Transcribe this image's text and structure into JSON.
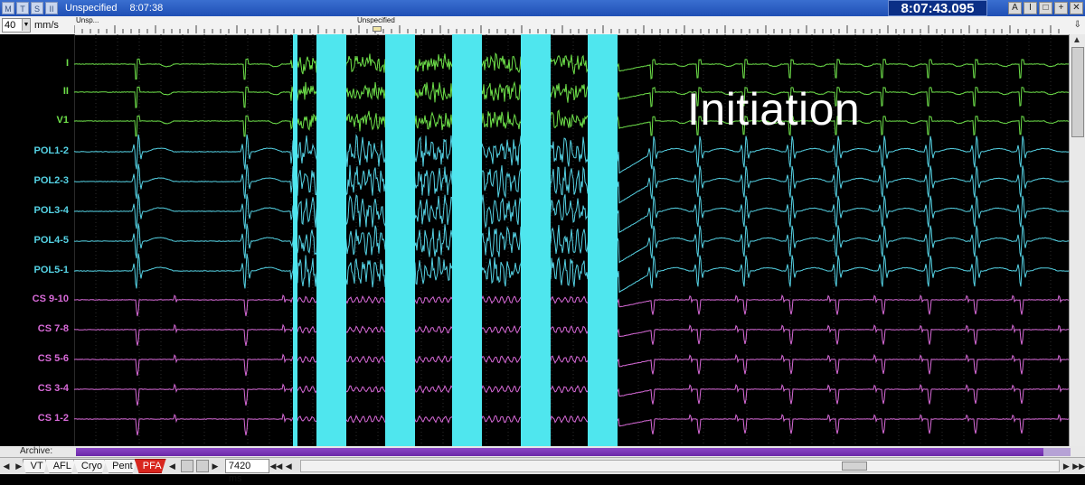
{
  "titlebar": {
    "buttons": [
      "M",
      "T",
      "S",
      "II"
    ],
    "title": "Unspecified",
    "time": "8:07:38",
    "clock": "8:07:43.095",
    "window_buttons": [
      "A",
      "I",
      "□",
      "+",
      "✕"
    ]
  },
  "toolbar": {
    "speed_value": "40",
    "speed_unit": "mm/s",
    "marker_left": "Unsp...",
    "marker_center": "Unspecified"
  },
  "channels": [
    {
      "label": "I",
      "color": "#6ee04a"
    },
    {
      "label": "II",
      "color": "#6ee04a"
    },
    {
      "label": "V1",
      "color": "#6ee04a"
    },
    {
      "label": "POL1-2",
      "color": "#55d2e4"
    },
    {
      "label": "POL2-3",
      "color": "#55d2e4"
    },
    {
      "label": "POL3-4",
      "color": "#55d2e4"
    },
    {
      "label": "POL4-5",
      "color": "#55d2e4"
    },
    {
      "label": "POL5-1",
      "color": "#55d2e4"
    },
    {
      "label": "CS 9-10",
      "color": "#d86ad8"
    },
    {
      "label": "CS 7-8",
      "color": "#d86ad8"
    },
    {
      "label": "CS 5-6",
      "color": "#d86ad8"
    },
    {
      "label": "CS 3-4",
      "color": "#d86ad8"
    },
    {
      "label": "CS 1-2",
      "color": "#d86ad8"
    }
  ],
  "annotation": "Initiation",
  "artifact_color": "#4fe6ee",
  "archive": {
    "label": "Archive:"
  },
  "bottombar": {
    "tabs": [
      "VT",
      "AFL",
      "Cryo",
      "Pent",
      "PFA"
    ],
    "active_tab": "PFA",
    "duration": "7420 ms",
    "nav_icons": [
      "first-icon",
      "prev-icon",
      "next-icon",
      "last-icon"
    ]
  }
}
